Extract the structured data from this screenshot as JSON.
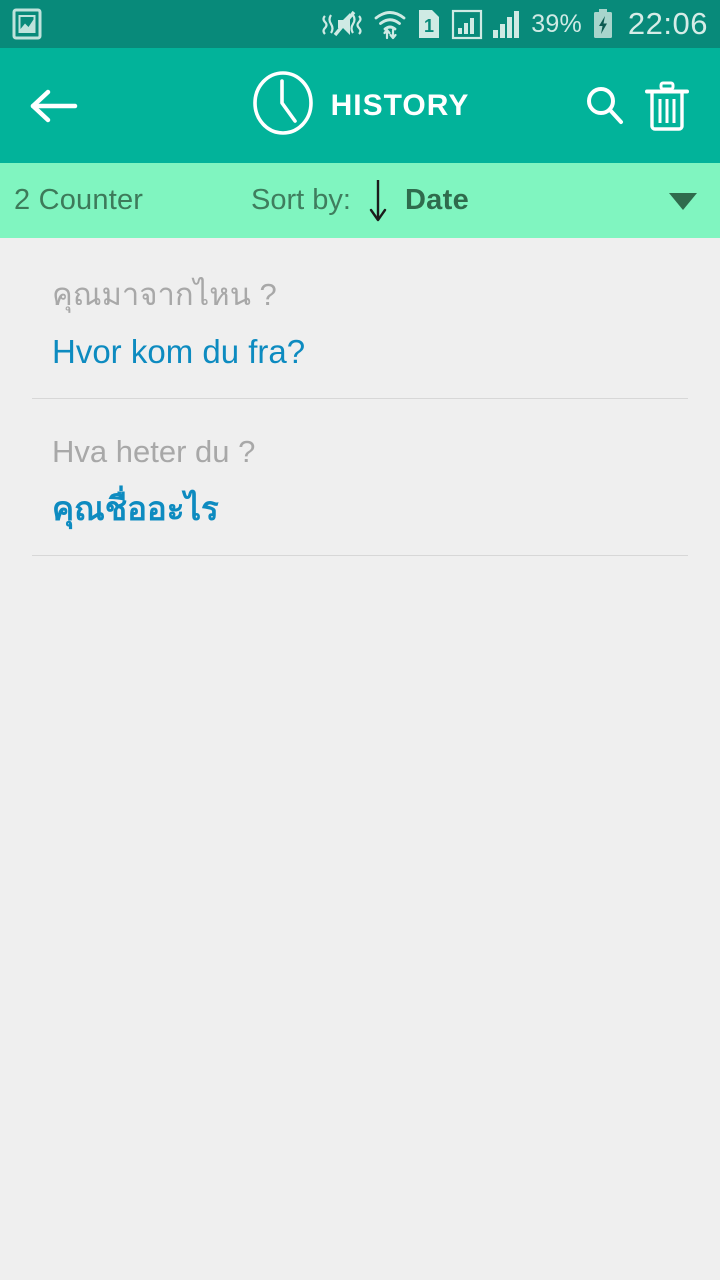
{
  "status_bar": {
    "background": "#088a7a",
    "left_icons": [
      {
        "name": "screenshot-notification-icon",
        "glyph": "image"
      }
    ],
    "right_icons": [
      {
        "name": "vibrate-mute-icon",
        "glyph": "mute"
      },
      {
        "name": "wifi-transfer-icon",
        "glyph": "wifi"
      },
      {
        "name": "sim-card-1-icon",
        "glyph": "sim",
        "label": "1"
      },
      {
        "name": "signal-bars-boxed-icon",
        "glyph": "signal-boxed"
      },
      {
        "name": "signal-bars-icon",
        "glyph": "signal"
      }
    ],
    "battery_percent": "39%",
    "battery_state": "charging",
    "time": "22:06"
  },
  "app_bar": {
    "background": "#02b39a",
    "back_label": "Back",
    "clock_icon": "history-clock-icon",
    "title": "HISTORY",
    "search_label": "Search",
    "delete_label": "Delete all"
  },
  "sort_bar": {
    "background": "#80f5c0",
    "counter": "2 Counter",
    "sort_by_label": "Sort by:",
    "sort_direction": "descending",
    "sort_value": "Date",
    "dropdown_icon": "chevron-down-icon"
  },
  "list": {
    "items": [
      {
        "source_text": "คุณมาจากไหน ?",
        "target_text": "Hvor kom du fra?",
        "target_bold": false
      },
      {
        "source_text": "Hva heter du ?",
        "target_text": "คุณชื่ออะไร",
        "target_bold": true
      }
    ]
  },
  "colors": {
    "status_bar": "#088a7a",
    "app_bar": "#02b39a",
    "sort_bar": "#80f5c0",
    "body": "#efefef",
    "accent_blue": "#0d8bc0",
    "muted_grey": "#a8a8a8"
  }
}
